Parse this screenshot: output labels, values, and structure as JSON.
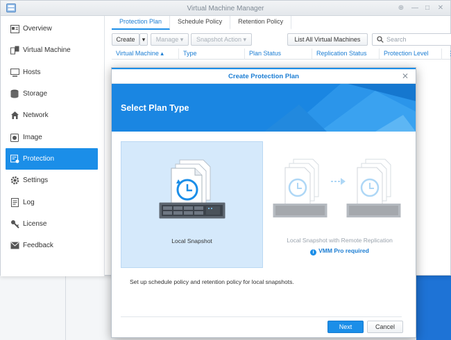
{
  "window": {
    "title": "Virtual Machine Manager",
    "controls": [
      "pin-icon",
      "minimize-icon",
      "maximize-icon",
      "close-icon"
    ]
  },
  "sidebar": {
    "items": [
      {
        "label": "Overview",
        "icon": "overview-icon"
      },
      {
        "label": "Virtual Machine",
        "icon": "virtual-machine-icon"
      },
      {
        "label": "Hosts",
        "icon": "hosts-icon"
      },
      {
        "label": "Storage",
        "icon": "storage-icon"
      },
      {
        "label": "Network",
        "icon": "network-icon"
      },
      {
        "label": "Image",
        "icon": "image-icon"
      },
      {
        "label": "Protection",
        "icon": "protection-icon",
        "active": true
      },
      {
        "label": "Settings",
        "icon": "settings-icon"
      },
      {
        "label": "Log",
        "icon": "log-icon"
      },
      {
        "label": "License",
        "icon": "license-icon"
      },
      {
        "label": "Feedback",
        "icon": "feedback-icon"
      }
    ]
  },
  "tabs": [
    {
      "label": "Protection Plan",
      "active": true
    },
    {
      "label": "Schedule Policy"
    },
    {
      "label": "Retention Policy"
    }
  ],
  "toolbar": {
    "create": "Create",
    "manage": "Manage",
    "snapshot_action": "Snapshot Action",
    "list_all": "List All Virtual Machines",
    "search_placeholder": "Search"
  },
  "grid": {
    "columns": [
      "Virtual Machine",
      "Type",
      "Plan Status",
      "Replication Status",
      "Protection Level"
    ]
  },
  "dialog": {
    "title": "Create Protection Plan",
    "heading": "Select Plan Type",
    "options": [
      {
        "label": "Local Snapshot",
        "selected": true
      },
      {
        "label": "Local Snapshot with Remote Replication",
        "note": "VMM Pro required",
        "disabled": true
      }
    ],
    "description": "Set up schedule policy and retention policy for local snapshots.",
    "next": "Next",
    "cancel": "Cancel"
  },
  "colors": {
    "accent": "#1b8ee8",
    "selected_bg": "#d5e9fb",
    "banner": "#1a86e2"
  }
}
